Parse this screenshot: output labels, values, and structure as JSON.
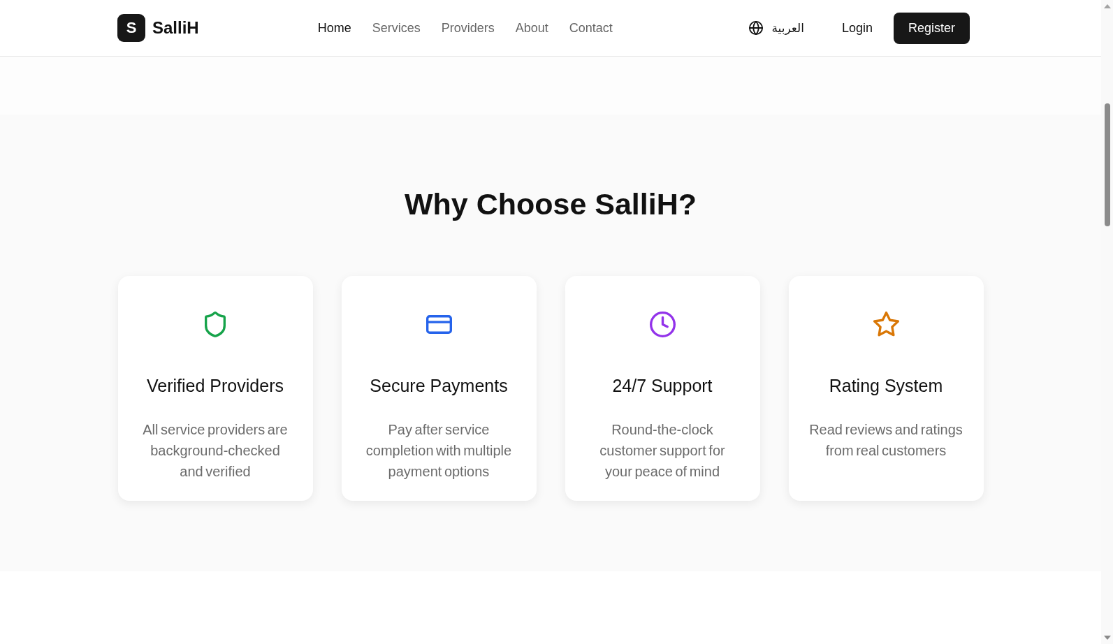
{
  "header": {
    "logo": {
      "mark": "S",
      "name": "SalliH"
    },
    "nav": [
      {
        "label": "Home",
        "selected": true
      },
      {
        "label": "Services",
        "selected": false
      },
      {
        "label": "Providers",
        "selected": false
      },
      {
        "label": "About",
        "selected": false
      },
      {
        "label": "Contact",
        "selected": false
      }
    ],
    "language_switch": "العربية",
    "login": "Login",
    "register": "Register"
  },
  "features_section": {
    "title": "Why Choose SalliH?",
    "features": [
      {
        "kind": "shield",
        "color": "#16a34a",
        "title": "Verified Providers",
        "description": "All service providers are background-checked and verified"
      },
      {
        "kind": "card",
        "color": "#2563eb",
        "title": "Secure Payments",
        "description": "Pay after service completion with multiple payment options"
      },
      {
        "kind": "clock",
        "color": "#9333ea",
        "title": "24/7 Support",
        "description": "Round-the-clock customer support for your peace of mind"
      },
      {
        "kind": "star",
        "color": "#d97706",
        "title": "Rating System",
        "description": "Read reviews and ratings from real customers"
      }
    ]
  }
}
